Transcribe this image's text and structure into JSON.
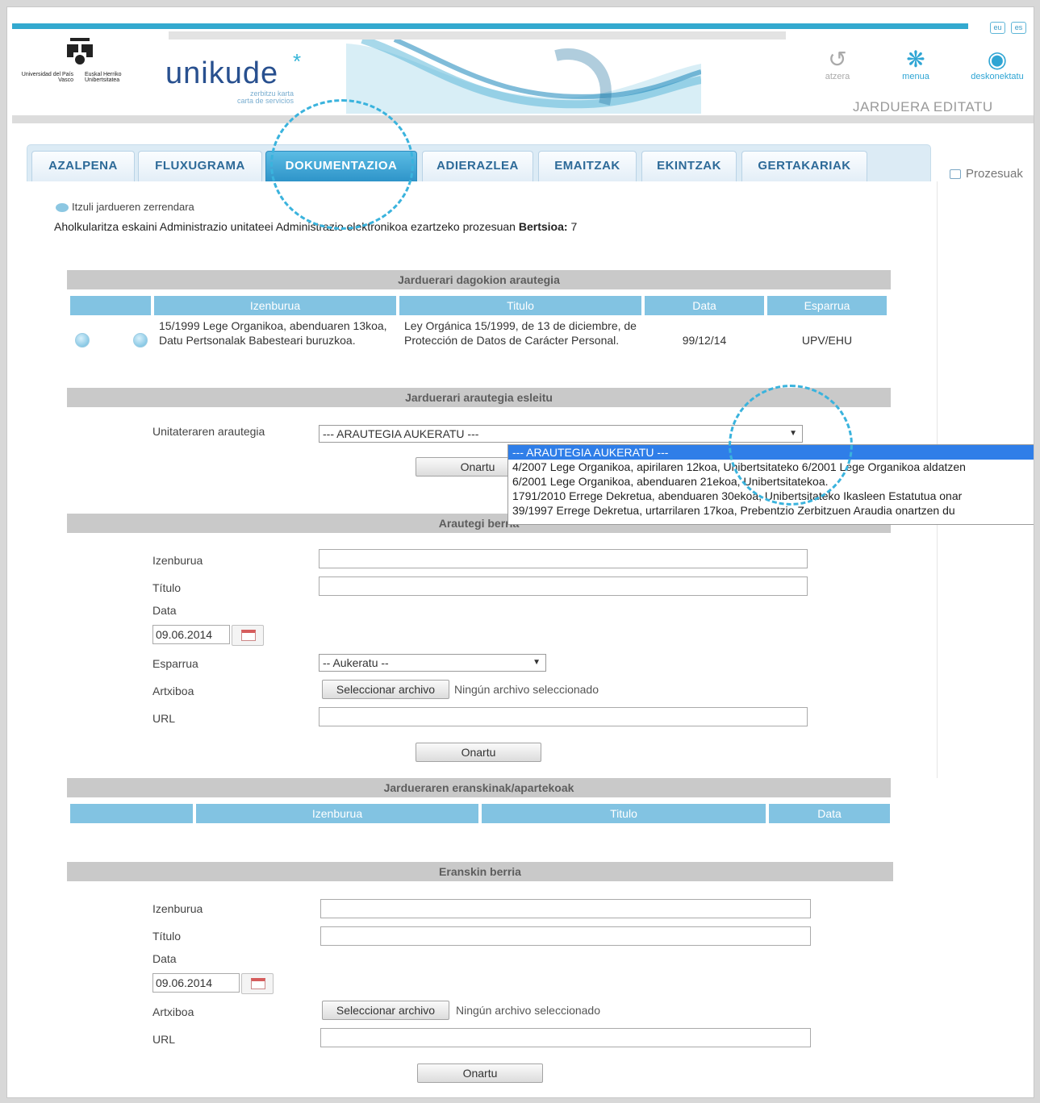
{
  "header": {
    "org_line1": "Universidad del País Vasco",
    "org_line2": "Euskal Herriko Unibertsitatea",
    "brand": "unikude",
    "brand_star": "*",
    "brand_sub1": "zerbitzu karta",
    "brand_sub2": "carta de servicios",
    "lang_eu": "eu",
    "lang_es": "es",
    "btn_back": "atzera",
    "btn_menu": "menua",
    "btn_logout": "deskonektatu",
    "page_heading": "JARDUERA EDITATU"
  },
  "tabs": [
    "AZALPENA",
    "FLUXUGRAMA",
    "DOKUMENTAZIOA",
    "ADIERAZLEA",
    "EMAITZAK",
    "EKINTZAK",
    "GERTAKARIAK"
  ],
  "side_link": "Prozesuak",
  "back_link": "Itzuli jardueren zerrendara",
  "process_line": "Aholkularitza eskaini Administrazio unitateei Administrazio elektronikoa ezartzeko prozesuan",
  "version_label": "Bertsioa:",
  "version_value": "7",
  "regs": {
    "title": "Jarduerari dagokion arautegia",
    "headers": [
      "Izenburua",
      "Titulo",
      "Data",
      "Esparrua"
    ],
    "row": {
      "izenburua": "15/1999 Lege Organikoa, abenduaren 13koa, Datu Pertsonalak Babesteari buruzkoa.",
      "titulo": "Ley Orgánica 15/1999, de 13 de diciembre, de Protección de Datos de Carácter Personal.",
      "data": "99/12/14",
      "esparrua": "UPV/EHU"
    }
  },
  "assign": {
    "title": "Jarduerari arautegia esleitu",
    "label": "Unitateraren arautegia",
    "select_value": "--- ARAUTEGIA AUKERATU ---",
    "button": "Onartu",
    "options": [
      "--- ARAUTEGIA AUKERATU ---",
      "4/2007 Lege Organikoa, apirilaren 12koa, Unibertsitateko 6/2001 Lege Organikoa aldatzen",
      "6/2001 Lege Organikoa, abenduaren 21ekoa, Unibertsitatekoa.",
      "1791/2010 Errege Dekretua, abenduaren 30ekoa, Unibertsitateko Ikasleen Estatutua onar",
      "39/1997 Errege Dekretua, urtarrilaren 17koa, Prebentzio Zerbitzuen Araudia onartzen du"
    ]
  },
  "new_reg": {
    "title": "Arautegi berria",
    "label_izenburua": "Izenburua",
    "label_titulo": "Título",
    "label_data": "Data",
    "date_value": "09.06.2014",
    "label_esparrua": "Esparrua",
    "esparrua_value": "-- Aukeratu --",
    "label_artxiboa": "Artxiboa",
    "file_button": "Seleccionar archivo",
    "file_status": "Ningún archivo seleccionado",
    "label_url": "URL",
    "button": "Onartu"
  },
  "annexes": {
    "title": "Jardueraren eranskinak/apartekoak",
    "headers": [
      "Izenburua",
      "Titulo",
      "Data"
    ]
  },
  "new_annex": {
    "title": "Eranskin berria",
    "label_izenburua": "Izenburua",
    "label_titulo": "Título",
    "label_data": "Data",
    "date_value": "09.06.2014",
    "label_artxiboa": "Artxiboa",
    "file_button": "Seleccionar archivo",
    "file_status": "Ningún archivo seleccionado",
    "label_url": "URL",
    "button": "Onartu"
  },
  "colors": {
    "accent": "#33a9cf",
    "tab_active": "#2e94c9",
    "table_header": "#82c3e2",
    "section_bar": "#c9c9c9",
    "highlight": "#2f7ee8"
  }
}
